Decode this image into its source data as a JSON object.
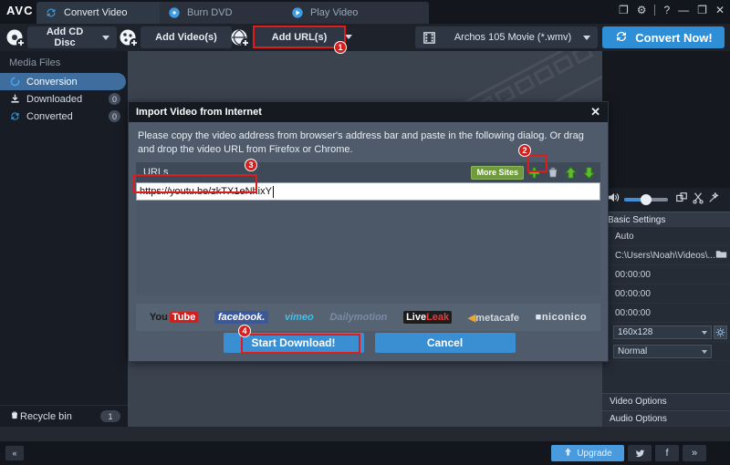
{
  "app": {
    "logo": "AVC",
    "tabs": [
      {
        "label": "Convert Video",
        "icon": "refresh-icon",
        "active": true
      },
      {
        "label": "Burn DVD",
        "icon": "disc-icon",
        "active": false
      },
      {
        "label": "Play Video",
        "icon": "play-icon",
        "active": false
      }
    ],
    "window_controls": [
      {
        "name": "screenshot-icon",
        "glyph": "❐"
      },
      {
        "name": "settings-gear-icon",
        "glyph": "⚙"
      },
      {
        "name": "help-icon",
        "glyph": "?"
      },
      {
        "name": "minimize-icon",
        "glyph": "—"
      },
      {
        "name": "maximize-icon",
        "glyph": "❐"
      },
      {
        "name": "close-icon",
        "glyph": "✕"
      }
    ]
  },
  "toolbar": {
    "add_cd_disc": "Add CD Disc",
    "add_videos": "Add Video(s)",
    "add_urls": "Add URL(s)",
    "profile": "Archos 105 Movie (*.wmv)",
    "convert_now": "Convert Now!"
  },
  "sidebar": {
    "title": "Media Files",
    "items": [
      {
        "label": "Conversion",
        "icon": "conversion-icon",
        "badge": "",
        "active": true
      },
      {
        "label": "Downloaded",
        "icon": "download-icon",
        "badge": "0",
        "active": false
      },
      {
        "label": "Converted",
        "icon": "converted-icon",
        "badge": "0",
        "active": false
      }
    ],
    "recycle_bin": {
      "label": "Recycle bin",
      "count": "1"
    }
  },
  "right_panel": {
    "controls": [
      {
        "name": "volume-icon"
      },
      {
        "name": "volume-slider"
      },
      {
        "name": "crop-icon"
      },
      {
        "name": "trim-scissors-icon"
      },
      {
        "name": "effects-wand-icon"
      }
    ],
    "basic_settings_header": "Basic Settings",
    "rows": [
      {
        "label": "",
        "value": "Auto",
        "type": "text"
      },
      {
        "label": "",
        "value": "C:\\Users\\Noah\\Videos\\...",
        "type": "path"
      },
      {
        "label": "",
        "value": "00:00:00",
        "type": "time"
      },
      {
        "label": "",
        "value": "00:00:00",
        "type": "time"
      },
      {
        "label": "",
        "value": "00:00:00",
        "type": "time"
      },
      {
        "label": "",
        "value": "160x128",
        "type": "select-gear"
      },
      {
        "label": "",
        "value": "Normal",
        "type": "select"
      }
    ],
    "video_options": "Video Options",
    "audio_options": "Audio Options"
  },
  "bottom_bar": {
    "collapse": "«",
    "upgrade": "Upgrade",
    "social": [
      {
        "name": "twitter-icon",
        "glyph": "ᵛ"
      },
      {
        "name": "facebook-icon",
        "glyph": "f"
      },
      {
        "name": "more-share-icon",
        "glyph": "»"
      }
    ]
  },
  "dialog": {
    "title": "Import Video from Internet",
    "close": "✕",
    "description": "Please copy the video address from browser's address bar and paste in the following dialog. Or drag and drop the video URL from Firefox or Chrome.",
    "urls_label": "URLs",
    "more_sites": "More Sites",
    "url_value": "https://youtu.be/zkTX1eNhixY",
    "url_placeholder": "",
    "toolbar_icons": [
      {
        "name": "add-url-plus-icon",
        "glyph": "+"
      },
      {
        "name": "delete-trash-icon",
        "glyph": "Ὕ1"
      },
      {
        "name": "move-up-icon",
        "glyph": "↑"
      },
      {
        "name": "move-down-icon",
        "glyph": "↓"
      }
    ],
    "site_logos": [
      {
        "name": "youtube-logo",
        "part1": "You",
        "part2": "Tube"
      },
      {
        "name": "facebook-logo",
        "text": "facebook."
      },
      {
        "name": "vimeo-logo",
        "text": "vimeo"
      },
      {
        "name": "dailymotion-logo",
        "text": "Dailymotion"
      },
      {
        "name": "liveleak-logo",
        "part1": "Live",
        "part2": "Leak"
      },
      {
        "name": "metacafe-logo",
        "text": "metacafe"
      },
      {
        "name": "niconico-logo",
        "text": "niconico"
      }
    ],
    "start_download": "Start Download!",
    "cancel": "Cancel"
  },
  "annotations": {
    "steps": [
      "1",
      "2",
      "3",
      "4"
    ],
    "highlight_color": "#e01b1b"
  }
}
